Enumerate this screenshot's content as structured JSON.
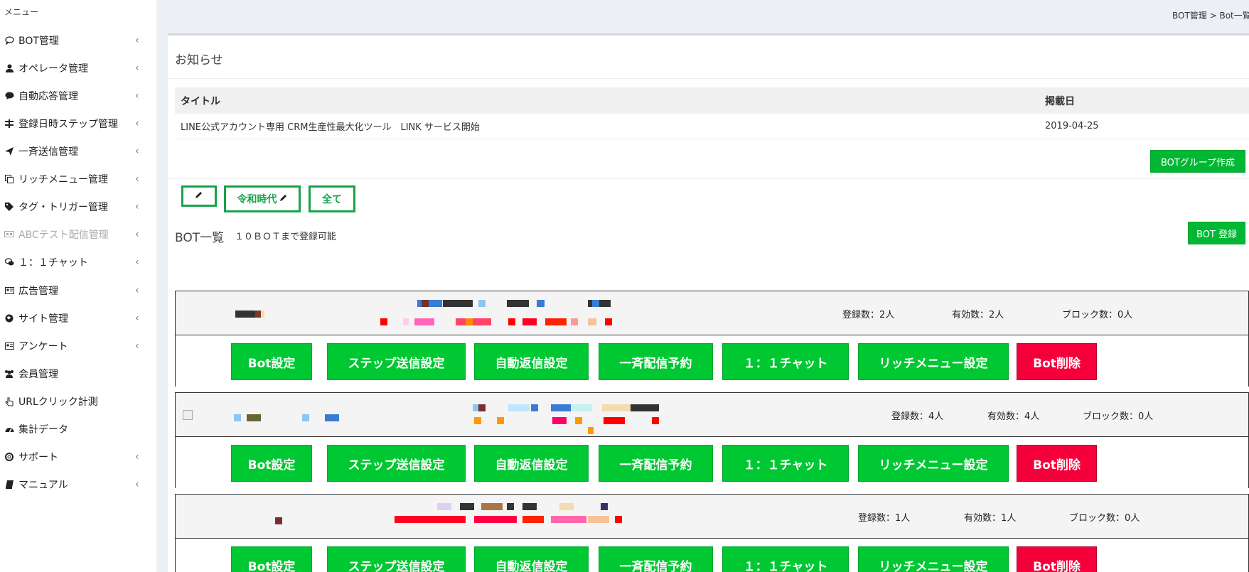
{
  "breadcrumb": "BOT管理 > Bot一覧",
  "sidebar": {
    "header": "メニュー",
    "items": [
      {
        "label": "BOT管理",
        "icon": "speech-bubble-icon",
        "chevron": true,
        "disabled": false
      },
      {
        "label": "オペレータ管理",
        "icon": "user-icon",
        "chevron": true,
        "disabled": false
      },
      {
        "label": "自動応答管理",
        "icon": "comment-icon",
        "chevron": true,
        "disabled": false
      },
      {
        "label": "登録日時ステップ管理",
        "icon": "step-icon",
        "chevron": true,
        "disabled": false
      },
      {
        "label": "一斉送信管理",
        "icon": "paper-plane-icon",
        "chevron": true,
        "disabled": false
      },
      {
        "label": "リッチメニュー管理",
        "icon": "copy-icon",
        "chevron": true,
        "disabled": false
      },
      {
        "label": "タグ・トリガー管理",
        "icon": "tags-icon",
        "chevron": true,
        "disabled": false
      },
      {
        "label": "ABCテスト配信管理",
        "icon": "abtest-icon",
        "chevron": true,
        "disabled": true
      },
      {
        "label": "１：１チャット",
        "icon": "chat-icon",
        "chevron": true,
        "disabled": false
      },
      {
        "label": "広告管理",
        "icon": "newspaper-icon",
        "chevron": true,
        "disabled": false
      },
      {
        "label": "サイト管理",
        "icon": "globe-icon",
        "chevron": true,
        "disabled": false
      },
      {
        "label": "アンケート",
        "icon": "survey-icon",
        "chevron": true,
        "disabled": false
      },
      {
        "label": "会員管理",
        "icon": "users-icon",
        "chevron": false,
        "disabled": false
      },
      {
        "label": "URLクリック計測",
        "icon": "pointer-icon",
        "chevron": false,
        "disabled": false
      },
      {
        "label": "集計データ",
        "icon": "dashboard-icon",
        "chevron": false,
        "disabled": false
      },
      {
        "label": "サポート",
        "icon": "lifebuoy-icon",
        "chevron": true,
        "disabled": false
      },
      {
        "label": "マニュアル",
        "icon": "book-icon",
        "chevron": true,
        "disabled": false
      }
    ]
  },
  "notice": {
    "title": "お知らせ",
    "columns": [
      "タイトル",
      "掲載日"
    ],
    "rows": [
      {
        "title": "LINE公式アカウント専用 CRM生産性最大化ツール　LINK サービス開始",
        "date": "2019-04-25"
      }
    ]
  },
  "group_create_button": "BOTグループ作成",
  "groups": {
    "edit_icon": "pencil-icon",
    "named_label": "令和時代",
    "all_label": "全て"
  },
  "bot_list": {
    "title": "BOT一覧",
    "subtitle": "１０ＢＯＴまで登録可能",
    "register_button": "BOT 登録",
    "actions": [
      "Bot設定",
      "ステップ送信設定",
      "自動返信設定",
      "一斉配信予約",
      "１：１チャット",
      "リッチメニュー設定",
      "Bot削除"
    ],
    "bots": [
      {
        "registered": "登録数：2人",
        "active": "有効数：2人",
        "blocked": "ブロック数：0人"
      },
      {
        "registered": "登録数：4人",
        "active": "有効数：4人",
        "blocked": "ブロック数：0人"
      },
      {
        "registered": "登録数：1人",
        "active": "有効数：1人",
        "blocked": "ブロック数：0人"
      }
    ]
  },
  "colors": {
    "primary_green": "#00c832",
    "danger_red": "#f5003a",
    "outline_green": "#17a34a"
  }
}
